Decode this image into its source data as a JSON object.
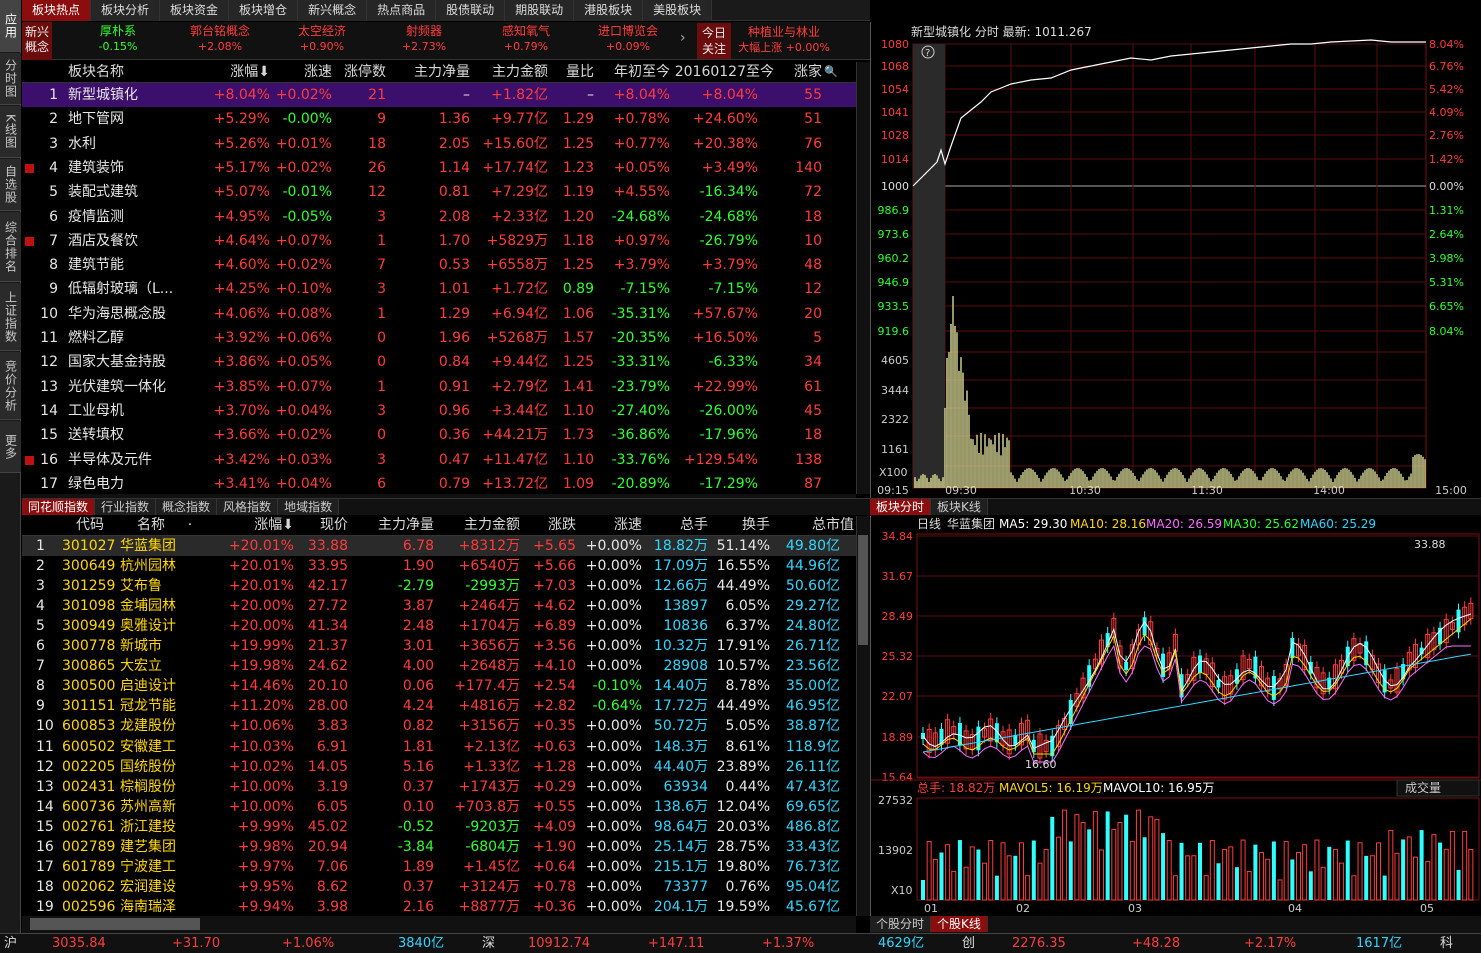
{
  "left_bar": [
    "应用",
    "分时图",
    "K线图",
    "自选股",
    "综合排名",
    "上证指数",
    "竞价分析",
    "更多"
  ],
  "top_tabs": [
    {
      "label": "板块热点",
      "active": true
    },
    {
      "label": "板块分析"
    },
    {
      "label": "板块资金"
    },
    {
      "label": "板块增仓"
    },
    {
      "label": "新兴概念"
    },
    {
      "label": "热点商品"
    },
    {
      "label": "股债联动"
    },
    {
      "label": "期股联动"
    },
    {
      "label": "港股板块"
    },
    {
      "label": "美股板块"
    }
  ],
  "concepts": {
    "label": "新兴概念",
    "items": [
      {
        "name": "厚朴系",
        "pct": "-0.15%",
        "neg": true
      },
      {
        "name": "郭台铭概念",
        "pct": "+2.08%"
      },
      {
        "name": "太空经济",
        "pct": "+0.90%"
      },
      {
        "name": "射频器",
        "pct": "+2.73%"
      },
      {
        "name": "感知氧气",
        "pct": "+0.79%"
      },
      {
        "name": "进口博览会",
        "pct": "+0.09%"
      }
    ],
    "arrow": "›",
    "today_label": "今日关注",
    "today_title": "种植业与林业",
    "today_sub": "大幅上涨",
    "today_pct": "+0.00%"
  },
  "table1": {
    "headers": [
      "板块名称",
      "涨幅⬇",
      "涨速",
      "涨停数",
      "主力净量",
      "主力金额",
      "量比",
      "年初至今",
      "20160127至今",
      "涨家"
    ],
    "search_icon": "🔍",
    "rows": [
      {
        "no": "1",
        "name": "新型城镇化",
        "pct": "+8.04%",
        "spd": "+0.02%",
        "zt": "21",
        "jl": "–",
        "je": "+1.82亿",
        "lb": "–",
        "nc": "+8.04%",
        "d16": "+8.04%",
        "zj": "55"
      },
      {
        "no": "2",
        "name": "地下管网",
        "pct": "+5.29%",
        "spd": "-0.00%",
        "zt": "9",
        "jl": "1.36",
        "je": "+9.77亿",
        "lb": "1.29",
        "nc": "+0.78%",
        "d16": "+24.60%",
        "zj": "51"
      },
      {
        "no": "3",
        "name": "水利",
        "pct": "+5.26%",
        "spd": "+0.01%",
        "zt": "18",
        "jl": "2.05",
        "je": "+15.60亿",
        "lb": "1.25",
        "nc": "+0.77%",
        "d16": "+20.38%",
        "zj": "76"
      },
      {
        "no": "4",
        "name": "建筑装饰",
        "pct": "+5.17%",
        "spd": "+0.02%",
        "zt": "26",
        "jl": "1.14",
        "je": "+17.74亿",
        "lb": "1.23",
        "nc": "+0.05%",
        "d16": "+3.49%",
        "zj": "140",
        "plus": true
      },
      {
        "no": "5",
        "name": "装配式建筑",
        "pct": "+5.07%",
        "spd": "-0.01%",
        "zt": "12",
        "jl": "0.81",
        "je": "+7.29亿",
        "lb": "1.19",
        "nc": "+4.55%",
        "d16": "-16.34%",
        "zj": "72"
      },
      {
        "no": "6",
        "name": "疫情监测",
        "pct": "+4.95%",
        "spd": "-0.05%",
        "zt": "3",
        "jl": "2.08",
        "je": "+2.33亿",
        "lb": "1.20",
        "nc": "-24.68%",
        "d16": "-24.68%",
        "zj": "18"
      },
      {
        "no": "7",
        "name": "酒店及餐饮",
        "pct": "+4.64%",
        "spd": "+0.07%",
        "zt": "1",
        "jl": "1.70",
        "je": "+5829万",
        "lb": "1.18",
        "nc": "+0.97%",
        "d16": "-26.79%",
        "zj": "10",
        "plus": true
      },
      {
        "no": "8",
        "name": "建筑节能",
        "pct": "+4.60%",
        "spd": "+0.02%",
        "zt": "7",
        "jl": "0.53",
        "je": "+6558万",
        "lb": "1.25",
        "nc": "+3.79%",
        "d16": "+3.79%",
        "zj": "48"
      },
      {
        "no": "9",
        "name": "低辐射玻璃（L...",
        "pct": "+4.25%",
        "spd": "+0.10%",
        "zt": "3",
        "jl": "1.01",
        "je": "+1.72亿",
        "lb": "0.89",
        "nc": "-7.15%",
        "d16": "-7.15%",
        "zj": "12"
      },
      {
        "no": "10",
        "name": "华为海思概念股",
        "pct": "+4.06%",
        "spd": "+0.08%",
        "zt": "1",
        "jl": "1.29",
        "je": "+6.94亿",
        "lb": "1.06",
        "nc": "-35.31%",
        "d16": "+57.67%",
        "zj": "20"
      },
      {
        "no": "11",
        "name": "燃料乙醇",
        "pct": "+3.92%",
        "spd": "+0.06%",
        "zt": "0",
        "jl": "1.96",
        "je": "+5268万",
        "lb": "1.57",
        "nc": "-20.35%",
        "d16": "+16.50%",
        "zj": "5"
      },
      {
        "no": "12",
        "name": "国家大基金持股",
        "pct": "+3.86%",
        "spd": "+0.05%",
        "zt": "0",
        "jl": "0.84",
        "je": "+9.44亿",
        "lb": "1.25",
        "nc": "-33.31%",
        "d16": "-6.33%",
        "zj": "34"
      },
      {
        "no": "13",
        "name": "光伏建筑一体化",
        "pct": "+3.85%",
        "spd": "+0.07%",
        "zt": "1",
        "jl": "0.91",
        "je": "+2.79亿",
        "lb": "1.41",
        "nc": "-23.79%",
        "d16": "+22.99%",
        "zj": "61"
      },
      {
        "no": "14",
        "name": "工业母机",
        "pct": "+3.70%",
        "spd": "+0.04%",
        "zt": "3",
        "jl": "0.96",
        "je": "+3.44亿",
        "lb": "1.10",
        "nc": "-27.40%",
        "d16": "-26.00%",
        "zj": "45"
      },
      {
        "no": "15",
        "name": "送转填权",
        "pct": "+3.66%",
        "spd": "+0.02%",
        "zt": "0",
        "jl": "0.36",
        "je": "+44.21万",
        "lb": "1.73",
        "nc": "-36.86%",
        "d16": "-17.96%",
        "zj": "18"
      },
      {
        "no": "16",
        "name": "半导体及元件",
        "pct": "+3.42%",
        "spd": "+0.03%",
        "zt": "3",
        "jl": "0.47",
        "je": "+11.47亿",
        "lb": "1.10",
        "nc": "-33.76%",
        "d16": "+129.54%",
        "zj": "138",
        "plus": true
      },
      {
        "no": "17",
        "name": "绿色电力",
        "pct": "+3.41%",
        "spd": "+0.04%",
        "zt": "6",
        "jl": "0.79",
        "je": "+13.72亿",
        "lb": "1.09",
        "nc": "-20.89%",
        "d16": "-17.29%",
        "zj": "87"
      }
    ]
  },
  "sub_tabs": [
    {
      "label": "同花顺指数",
      "active": true
    },
    {
      "label": "行业指数"
    },
    {
      "label": "概念指数"
    },
    {
      "label": "风格指数"
    },
    {
      "label": "地域指数"
    }
  ],
  "table2": {
    "headers": [
      "代码",
      "名称",
      "·",
      "涨幅⬇",
      "现价",
      "主力净量",
      "主力金额",
      "涨跌",
      "涨速",
      "总手",
      "换手",
      "总市值"
    ],
    "rows": [
      {
        "no": "1",
        "code": "301027",
        "name": "华蓝集团",
        "pct": "+20.01%",
        "px": "33.88",
        "jl": "6.78",
        "je": "+8312万",
        "zd": "+5.65",
        "sp": "+0.00%",
        "zs": "18.82万",
        "hs": "51.14%",
        "mv": "49.80亿"
      },
      {
        "no": "2",
        "code": "300649",
        "name": "杭州园林",
        "pct": "+20.01%",
        "px": "33.95",
        "jl": "1.90",
        "je": "+6540万",
        "zd": "+5.66",
        "sp": "+0.00%",
        "zs": "17.09万",
        "hs": "16.55%",
        "mv": "44.96亿"
      },
      {
        "no": "3",
        "code": "301259",
        "name": "艾布鲁",
        "pct": "+20.01%",
        "px": "42.17",
        "jl": "-2.79",
        "je": "-2993万",
        "zd": "+7.03",
        "sp": "+0.00%",
        "zs": "12.66万",
        "hs": "44.49%",
        "mv": "50.60亿"
      },
      {
        "no": "4",
        "code": "301098",
        "name": "金埔园林",
        "pct": "+20.00%",
        "px": "27.72",
        "jl": "3.87",
        "je": "+2464万",
        "zd": "+4.62",
        "sp": "+0.00%",
        "zs": "13897",
        "hs": "6.05%",
        "mv": "29.27亿"
      },
      {
        "no": "5",
        "code": "300949",
        "name": "奥雅设计",
        "pct": "+20.00%",
        "px": "41.34",
        "jl": "2.48",
        "je": "+1704万",
        "zd": "+6.89",
        "sp": "+0.00%",
        "zs": "10836",
        "hs": "6.37%",
        "mv": "24.80亿"
      },
      {
        "no": "6",
        "code": "300778",
        "name": "新城市",
        "pct": "+19.99%",
        "px": "21.37",
        "jl": "3.01",
        "je": "+3656万",
        "zd": "+3.56",
        "sp": "+0.00%",
        "zs": "10.32万",
        "hs": "17.91%",
        "mv": "26.71亿"
      },
      {
        "no": "7",
        "code": "300865",
        "name": "大宏立",
        "pct": "+19.98%",
        "px": "24.62",
        "jl": "4.00",
        "je": "+2648万",
        "zd": "+4.10",
        "sp": "+0.00%",
        "zs": "28908",
        "hs": "10.57%",
        "mv": "23.56亿"
      },
      {
        "no": "8",
        "code": "300500",
        "name": "启迪设计",
        "pct": "+14.46%",
        "px": "20.10",
        "jl": "0.06",
        "je": "+177.4万",
        "zd": "+2.54",
        "sp": "-0.10%",
        "zs": "14.40万",
        "hs": "8.78%",
        "mv": "35.00亿"
      },
      {
        "no": "9",
        "code": "301151",
        "name": "冠龙节能",
        "pct": "+11.20%",
        "px": "28.00",
        "jl": "4.24",
        "je": "+4816万",
        "zd": "+2.82",
        "sp": "-0.64%",
        "zs": "17.72万",
        "hs": "44.49%",
        "mv": "46.95亿"
      },
      {
        "no": "10",
        "code": "600853",
        "name": "龙建股份",
        "pct": "+10.06%",
        "px": "3.83",
        "jl": "0.82",
        "je": "+3156万",
        "zd": "+0.35",
        "sp": "+0.00%",
        "zs": "50.72万",
        "hs": "5.05%",
        "mv": "38.87亿"
      },
      {
        "no": "11",
        "code": "600502",
        "name": "安徽建工",
        "pct": "+10.03%",
        "px": "6.91",
        "jl": "1.81",
        "je": "+2.13亿",
        "zd": "+0.63",
        "sp": "+0.00%",
        "zs": "148.3万",
        "hs": "8.61%",
        "mv": "118.9亿"
      },
      {
        "no": "12",
        "code": "002205",
        "name": "国统股份",
        "pct": "+10.02%",
        "px": "14.05",
        "jl": "5.16",
        "je": "+1.33亿",
        "zd": "+1.28",
        "sp": "+0.00%",
        "zs": "44.40万",
        "hs": "23.89%",
        "mv": "26.11亿"
      },
      {
        "no": "13",
        "code": "002431",
        "name": "棕榈股份",
        "pct": "+10.00%",
        "px": "3.19",
        "jl": "0.37",
        "je": "+1743万",
        "zd": "+0.29",
        "sp": "+0.00%",
        "zs": "63934",
        "hs": "0.44%",
        "mv": "47.43亿"
      },
      {
        "no": "14",
        "code": "600736",
        "name": "苏州高新",
        "pct": "+10.00%",
        "px": "6.05",
        "jl": "0.10",
        "je": "+703.8万",
        "zd": "+0.55",
        "sp": "+0.00%",
        "zs": "138.6万",
        "hs": "12.04%",
        "mv": "69.65亿"
      },
      {
        "no": "15",
        "code": "002761",
        "name": "浙江建投",
        "pct": "+9.99%",
        "px": "45.02",
        "jl": "-0.52",
        "je": "-9203万",
        "zd": "+4.09",
        "sp": "+0.00%",
        "zs": "98.64万",
        "hs": "20.03%",
        "mv": "486.8亿"
      },
      {
        "no": "16",
        "code": "002789",
        "name": "建艺集团",
        "pct": "+9.98%",
        "px": "20.94",
        "jl": "-3.84",
        "je": "-6804万",
        "zd": "+1.90",
        "sp": "+0.00%",
        "zs": "25.14万",
        "hs": "28.75%",
        "mv": "33.43亿"
      },
      {
        "no": "17",
        "code": "601789",
        "name": "宁波建工",
        "pct": "+9.97%",
        "px": "7.06",
        "jl": "1.89",
        "je": "+1.45亿",
        "zd": "+0.64",
        "sp": "+0.00%",
        "zs": "215.1万",
        "hs": "19.80%",
        "mv": "76.73亿"
      },
      {
        "no": "18",
        "code": "002062",
        "name": "宏润建设",
        "pct": "+9.95%",
        "px": "8.62",
        "jl": "0.37",
        "je": "+3124万",
        "zd": "+0.78",
        "sp": "+0.00%",
        "zs": "73377",
        "hs": "0.76%",
        "mv": "95.04亿"
      },
      {
        "no": "19",
        "code": "002596",
        "name": "海南瑞泽",
        "pct": "+9.94%",
        "px": "3.98",
        "jl": "2.16",
        "je": "+8877万",
        "zd": "+0.36",
        "sp": "+0.00%",
        "zs": "204.1万",
        "hs": "19.59%",
        "mv": "45.67亿"
      }
    ]
  },
  "intraday": {
    "title": "新型城镇化 分时 最新: 1011.267",
    "help_icon": "?",
    "price_ticks": [
      "1080",
      "1068",
      "1054",
      "1041",
      "1028",
      "1014",
      "1000",
      "986.9",
      "973.6",
      "960.2",
      "946.9",
      "933.5",
      "919.6"
    ],
    "pct_ticks": [
      "8.04%",
      "6.76%",
      "5.42%",
      "4.09%",
      "2.76%",
      "1.42%",
      "0.00%",
      "1.31%",
      "2.64%",
      "3.98%",
      "5.31%",
      "6.65%",
      "8.04%"
    ],
    "vol_ticks": [
      "4605",
      "3444",
      "2322",
      "1161"
    ],
    "vol_unit": "X100",
    "time_ticks": [
      "09:15",
      "09:30",
      "10:30",
      "11:30",
      "14:00",
      "15:00"
    ]
  },
  "right_tabs_top": [
    {
      "label": "板块分时",
      "active": true
    },
    {
      "label": "板块K线"
    }
  ],
  "kline": {
    "title": "日线",
    "name": "华蓝集团",
    "ma5": "MA5: 29.30",
    "ma10": "MA10: 28.16",
    "ma20": "MA20: 26.59",
    "ma30": "MA30: 25.62",
    "ma60": "MA60: 25.29",
    "price_ticks": [
      "34.84",
      "31.67",
      "28.49",
      "25.32",
      "22.07",
      "18.89",
      "15.64"
    ],
    "high_label": "33.88",
    "low_label": "16.60",
    "vol_title": "总手: 18.82万",
    "mavol5": "MAVOL5: 16.19万",
    "mavol10": "MAVOL10: 16.95万",
    "vol_select": "成交量",
    "vol_ticks": [
      "27532",
      "13902"
    ],
    "vol_unit": "X10",
    "month_ticks": [
      "01",
      "02",
      "03",
      "04",
      "05"
    ]
  },
  "right_tabs_bot": [
    {
      "label": "个股分时"
    },
    {
      "label": "个股K线",
      "active": true
    }
  ],
  "status": {
    "sh": "沪",
    "sh_idx": "3035.84",
    "sh_chg": "+31.70",
    "sh_pct": "+1.06%",
    "sh_amt": "3840亿",
    "sz": "深",
    "sz_idx": "10912.74",
    "sz_chg": "+147.11",
    "sz_pct": "+1.37%",
    "sz_amt": "4629亿",
    "cy": "创",
    "cy_idx": "2276.35",
    "cy_chg": "+48.28",
    "cy_pct": "+2.17%",
    "cy_amt": "1617亿",
    "more": "科"
  }
}
